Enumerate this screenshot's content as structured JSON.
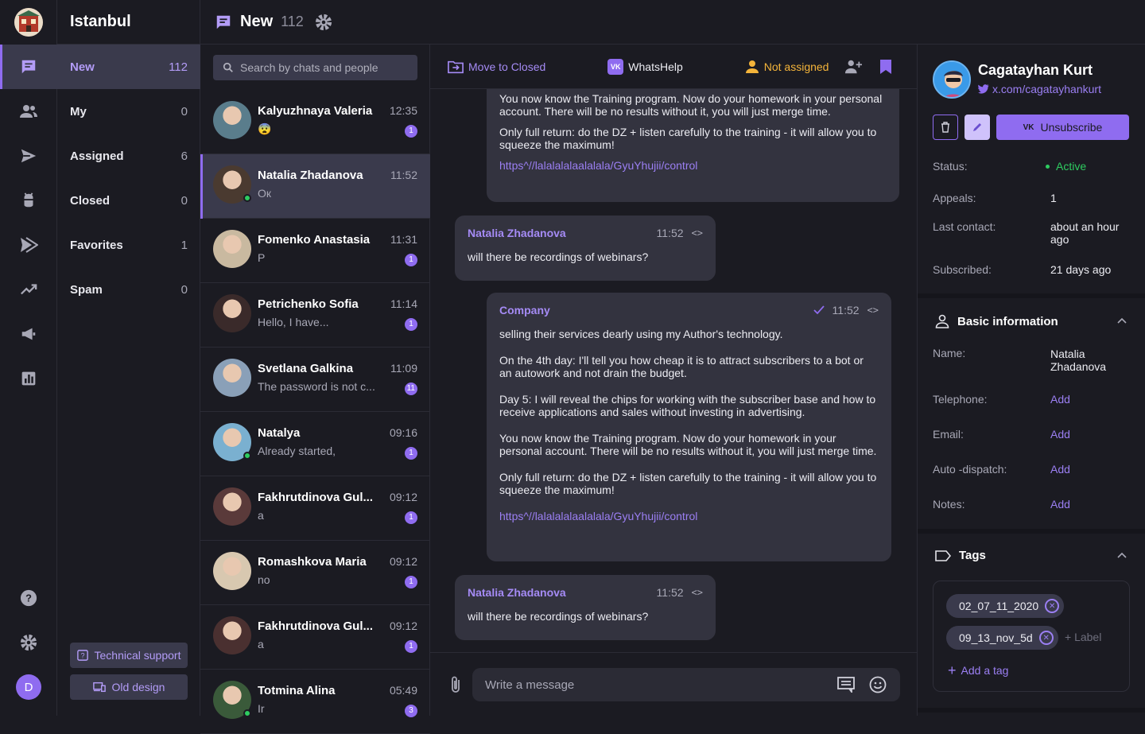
{
  "workspace": {
    "name": "Istanbul"
  },
  "header": {
    "title": "New",
    "count": "112"
  },
  "menu": {
    "items": [
      {
        "label": "New",
        "count": "112"
      },
      {
        "label": "My",
        "count": "0"
      },
      {
        "label": "Assigned",
        "count": "6"
      },
      {
        "label": "Closed",
        "count": "0"
      },
      {
        "label": "Favorites",
        "count": "1"
      },
      {
        "label": "Spam",
        "count": "0"
      }
    ],
    "support_label": "Technical support",
    "old_design_label": "Old design"
  },
  "user": {
    "initial": "D"
  },
  "search": {
    "placeholder": "Search by chats and people"
  },
  "chats": [
    {
      "name": "Kalyuzhnaya Valeria",
      "preview": "😨",
      "time": "12:35",
      "unread": "1",
      "color": "#5a7d8c"
    },
    {
      "name": "Natalia Zhadanova",
      "preview": "Ок",
      "time": "11:52",
      "unread": "",
      "color": "#4a3a30"
    },
    {
      "name": "Fomenko Anastasia",
      "preview": "Р",
      "time": "11:31",
      "unread": "1",
      "color": "#c9b9a0"
    },
    {
      "name": "Petrichenko Sofia",
      "preview": "Hello, I have...",
      "time": "11:14",
      "unread": "1",
      "color": "#3a2a2a"
    },
    {
      "name": "Svetlana Galkina",
      "preview": "The password is not c...",
      "time": "11:09",
      "unread": "11",
      "color": "#8aa0b8"
    },
    {
      "name": "Natalya",
      "preview": "Already started,",
      "time": "09:16",
      "unread": "1",
      "color": "#7ab0d0"
    },
    {
      "name": "Fakhrutdinova Gul...",
      "preview": "a",
      "time": "09:12",
      "unread": "1",
      "color": "#5a3a3a"
    },
    {
      "name": "Romashkova Maria",
      "preview": "no",
      "time": "09:12",
      "unread": "1",
      "color": "#d8c8b0"
    },
    {
      "name": "Fakhrutdinova Gul...",
      "preview": "a",
      "time": "09:12",
      "unread": "1",
      "color": "#4a3030"
    },
    {
      "name": "Totmina Alina",
      "preview": "Ir",
      "time": "05:49",
      "unread": "3",
      "color": "#3a5a3a"
    }
  ],
  "toolbar": {
    "move_label": "Move to Closed",
    "channel_label": "WhatsHelp",
    "assignee_label": "Not assigned"
  },
  "messages": {
    "m1": {
      "p1": "You now know the Training program. Now do your homework in your personal account. There will be no results without it, you will just merge time.",
      "p2": "Only full return: do the DZ + listen carefully to the training - it will allow you to squeeze the maximum!",
      "link": "https^//lalalalalaalalala/GyuYhujii/control"
    },
    "m2": {
      "author": "Natalia Zhadanova",
      "time": "11:52",
      "text": "will there be recordings of webinars?"
    },
    "m3": {
      "author": "Company",
      "time": "11:52",
      "p1": "selling their services dearly using my Author's technology.",
      "p2": "On the 4th day: I'll tell you how cheap it is to attract subscribers to a bot or an autowork and not drain the budget.",
      "p3": "Day 5: I will reveal the chips for working with the subscriber base and how to receive applications and sales without investing in advertising.",
      "p4": "You now know the Training program. Now do your homework in your personal account. There will be no results without it, you will just merge time.",
      "p5": "Only full return: do the DZ + listen carefully to the training - it will allow you to squeeze the maximum!",
      "link": "https^//lalalalalaalalala/GyuYhujii/control"
    },
    "m4": {
      "author": "Natalia Zhadanova",
      "time": "11:52",
      "text": "will there be recordings of webinars?"
    }
  },
  "composer": {
    "placeholder": "Write a message"
  },
  "profile": {
    "name": "Cagatayhan Kurt",
    "handle": "x.com/cagatayhankurt",
    "unsubscribe_label": "Unsubscribe",
    "status_label": "Status:",
    "status_value": "Active",
    "appeals_label": "Appeals:",
    "appeals_value": "1",
    "last_contact_label": "Last contact:",
    "last_contact_value": "about an hour ago",
    "subscribed_label": "Subscribed:",
    "subscribed_value": "21 days ago"
  },
  "basic_info": {
    "title": "Basic information",
    "name_label": "Name:",
    "name_value": "Natalia Zhadanova",
    "telephone_label": "Telephone:",
    "email_label": "Email:",
    "dispatch_label": "Auto -dispatch:",
    "notes_label": "Notes:",
    "add_label": "Add"
  },
  "tags": {
    "title": "Tags",
    "items": [
      "02_07_11_2020",
      "09_13_nov_5d"
    ],
    "label_placeholder": "+ Label",
    "add_label": "Add a tag"
  },
  "colors": {
    "accent": "#8f6cf0",
    "active_status": "#2ecc60",
    "assignee": "#f4b43a"
  }
}
